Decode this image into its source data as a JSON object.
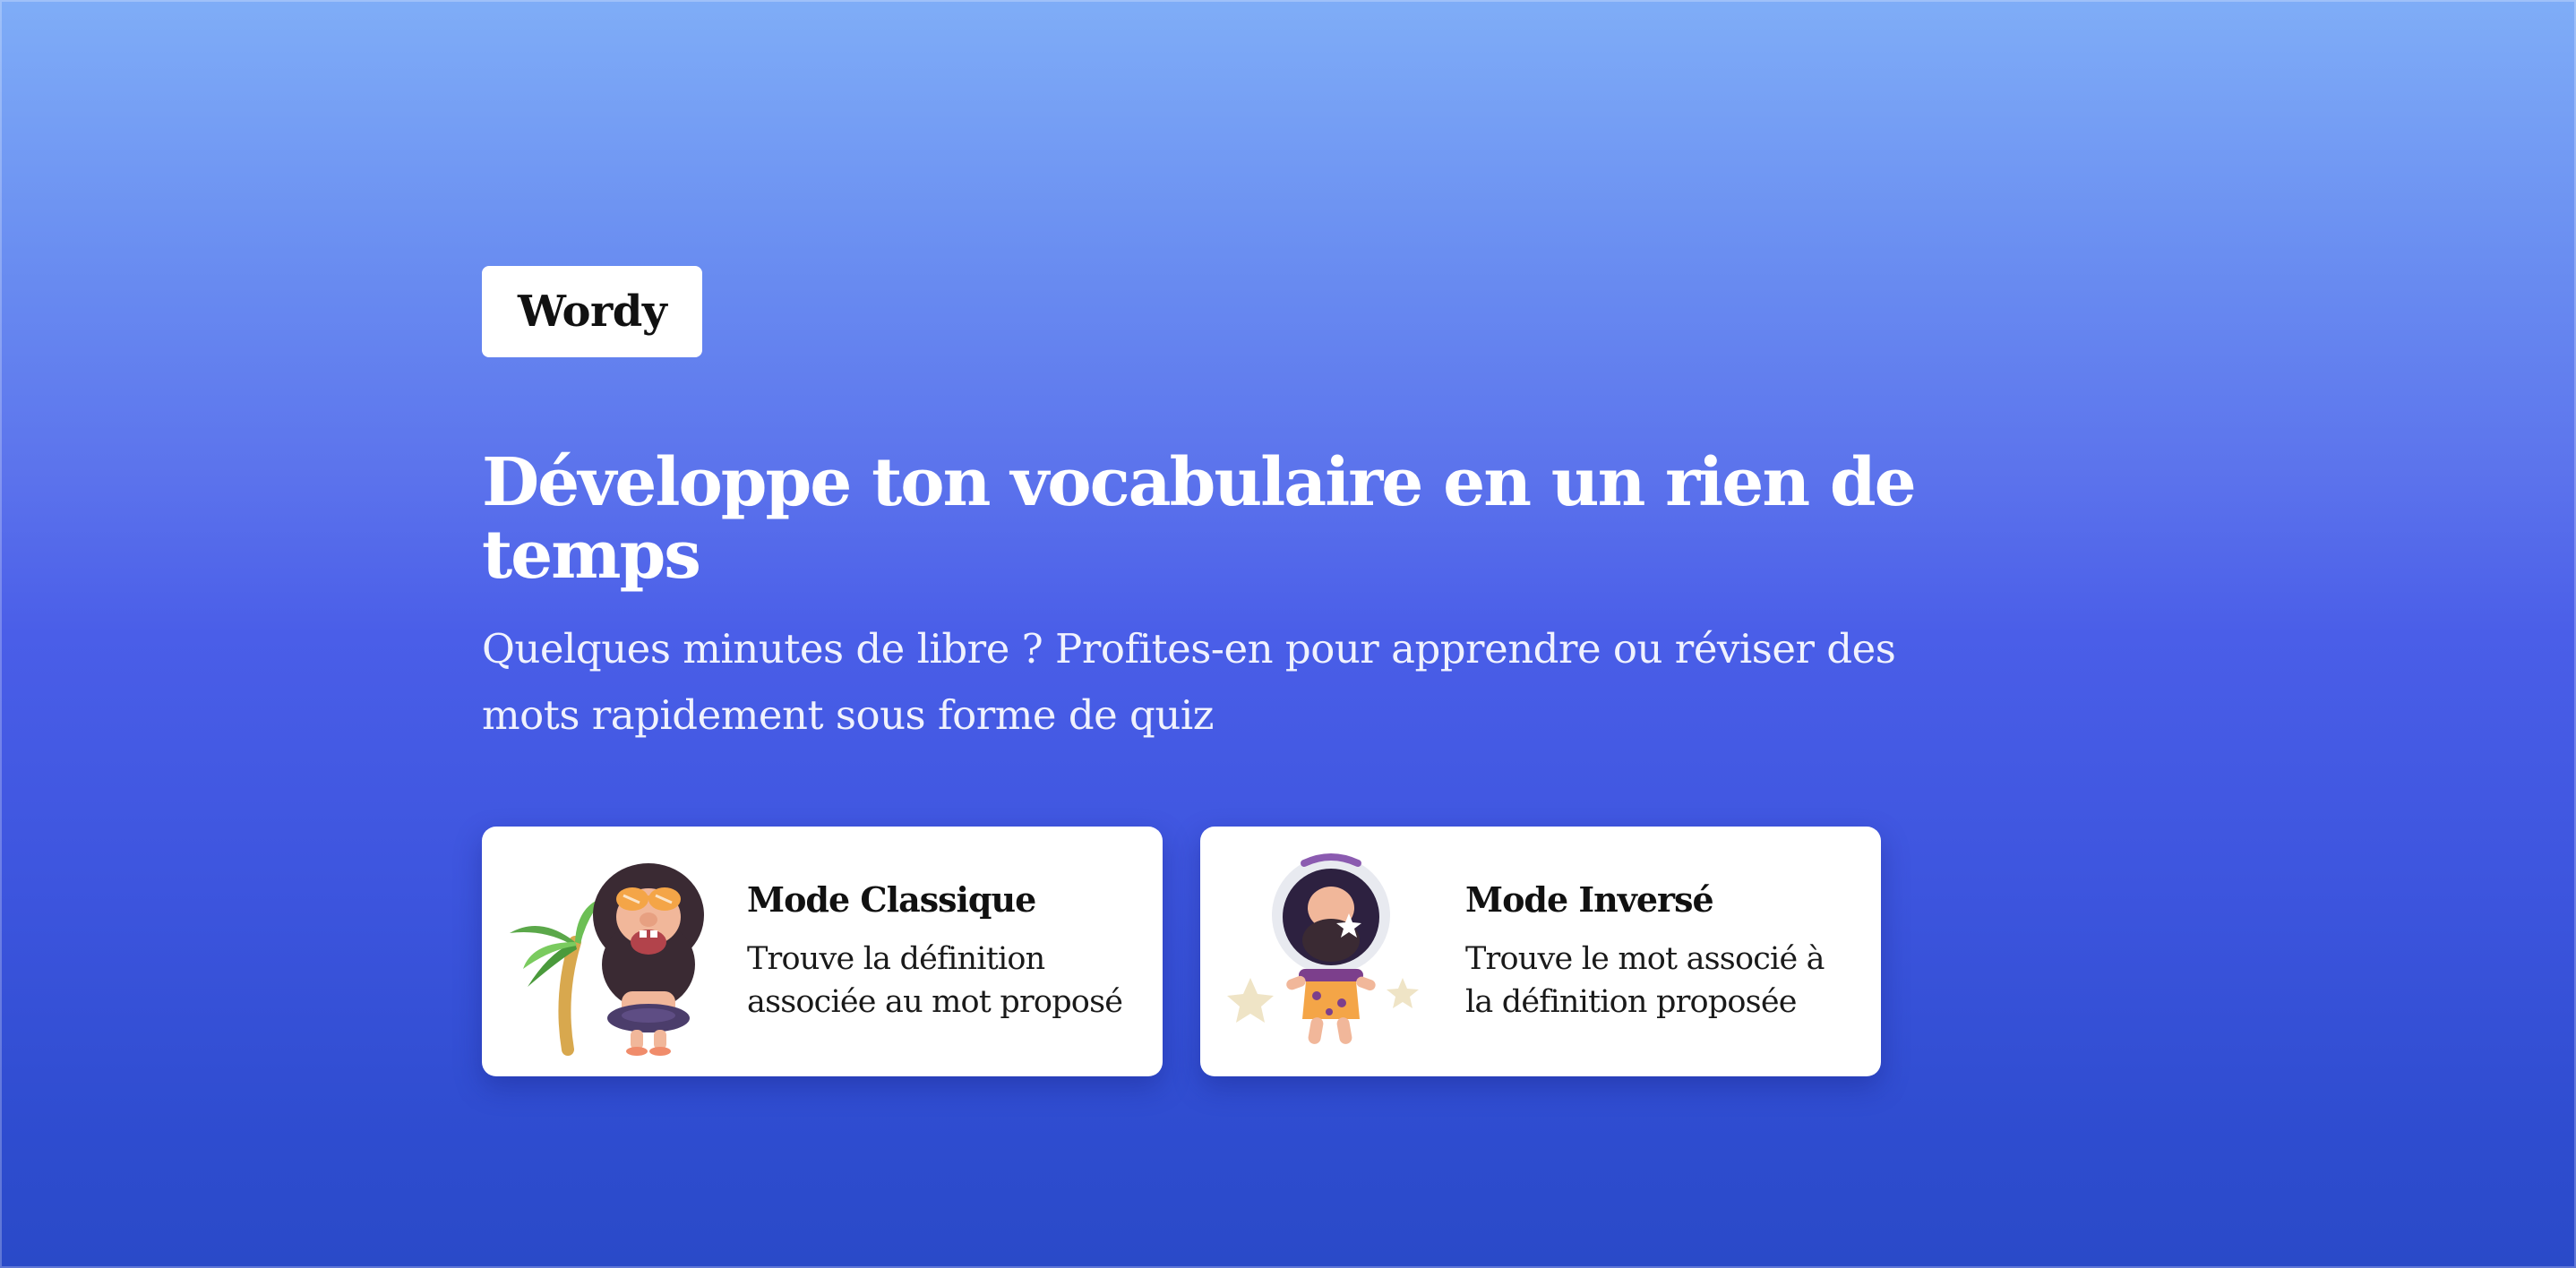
{
  "brand": {
    "logo_text": "Wordy"
  },
  "hero": {
    "title": "Développe ton vocabulaire en un rien de temps",
    "subtitle": "Quelques minutes de libre ? Profites-en pour apprendre ou réviser des mots rapidement sous forme de quiz"
  },
  "modes": [
    {
      "title": "Mode Classique",
      "description": "Trouve la définition associée au mot proposé",
      "illustration": "caveman-with-palm-tree"
    },
    {
      "title": "Mode Inversé",
      "description": "Trouve le mot associé à la définition proposée",
      "illustration": "caveman-astronaut"
    }
  ],
  "colors": {
    "background_top": "#7fadf7",
    "background_bottom": "#2a4ac8",
    "card_background": "#ffffff",
    "text_light": "#ffffff",
    "text_dark": "#111111"
  }
}
